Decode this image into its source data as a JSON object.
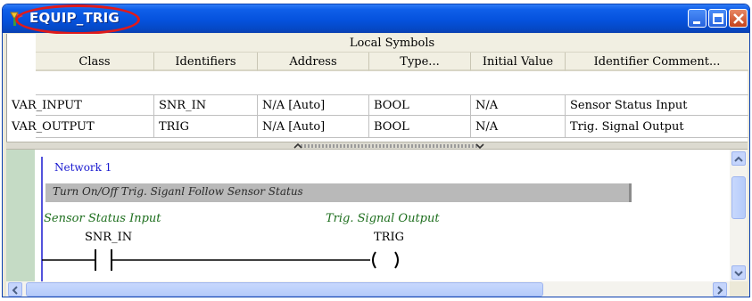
{
  "window": {
    "title": "EQUIP_TRIG"
  },
  "symbols": {
    "title": "Local Symbols",
    "columns": [
      "Class",
      "Identifiers",
      "Address",
      "Type...",
      "Initial Value",
      "Identifier Comment..."
    ],
    "rows": [
      [
        "VAR_INPUT",
        "SNR_IN",
        "N/A [Auto]",
        "BOOL",
        "N/A",
        "Sensor Status Input"
      ],
      [
        "VAR_OUTPUT",
        "TRIG",
        "N/A [Auto]",
        "BOOL",
        "N/A",
        "Trig. Signal Output"
      ]
    ]
  },
  "ladder": {
    "network_label": "Network 1",
    "network_comment": "Turn On/Off Trig. Siganl Follow Sensor Status",
    "contact": {
      "comment": "Sensor Status Input",
      "identifier": "SNR_IN"
    },
    "coil": {
      "comment": "Trig. Signal Output",
      "identifier": "TRIG"
    }
  },
  "icons": [
    "app-icon",
    "minimize-icon",
    "maximize-icon",
    "close-icon",
    "splitter-arrows-icon",
    "scroll-arrow-icons"
  ],
  "colors": {
    "titlebar": "#0552dd",
    "highlight": "#e01a1a",
    "comment_text": "#1d6e1d",
    "network_label": "#1a1ad0",
    "gutter": "#c5dbc5"
  }
}
